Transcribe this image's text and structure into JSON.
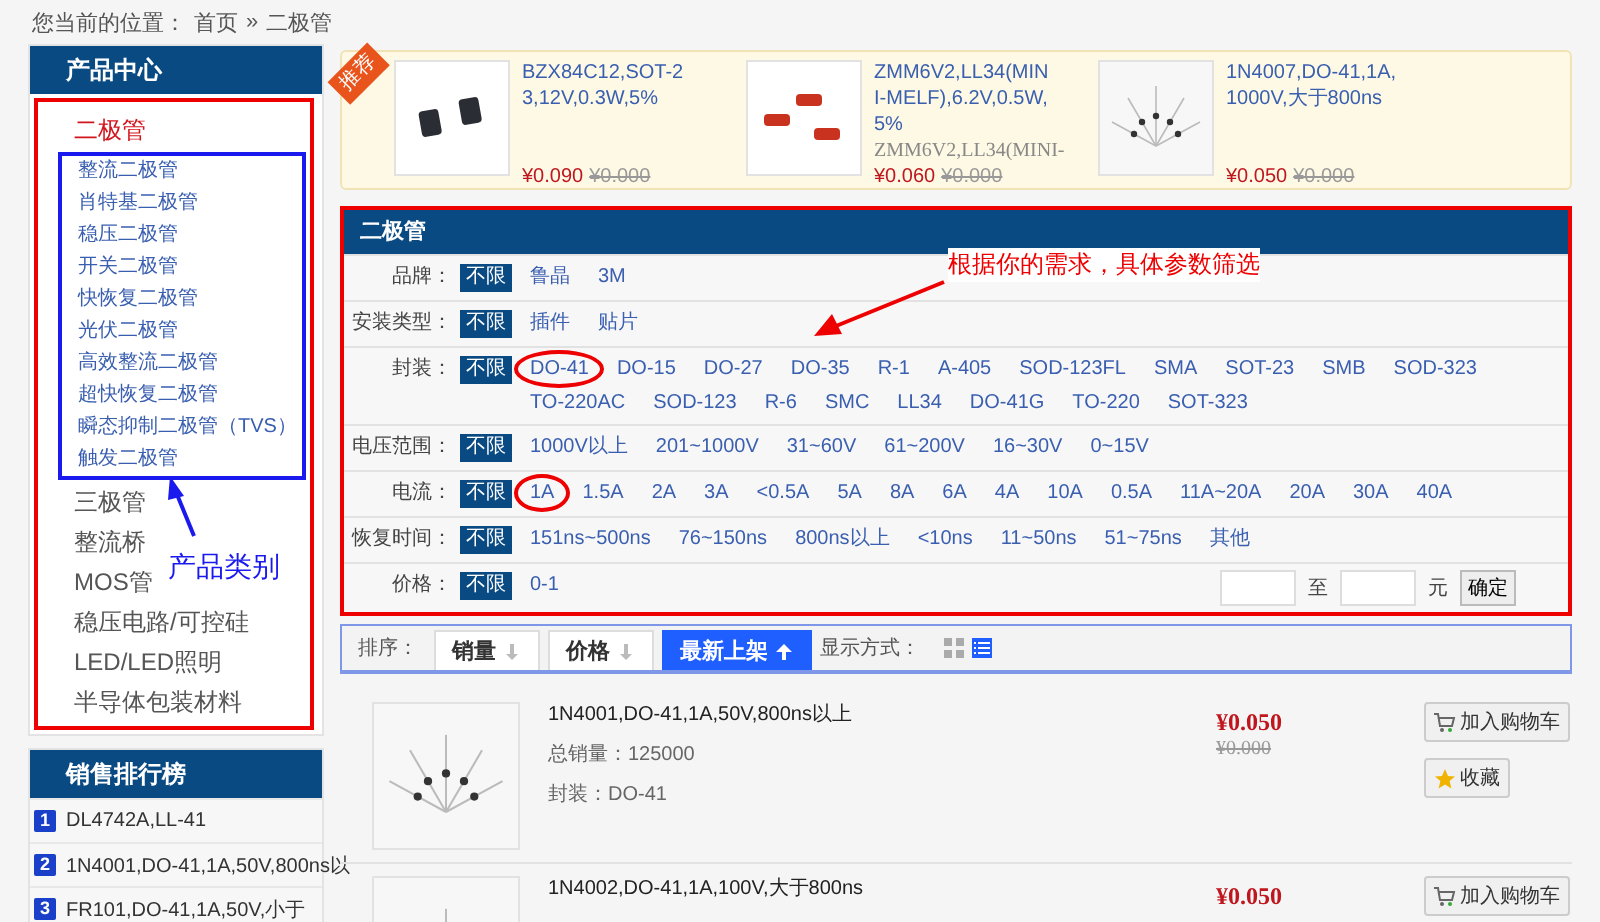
{
  "breadcrumb": {
    "prefix": "您当前的位置：",
    "home": "首页",
    "separator": "»",
    "current": "二极管"
  },
  "sidebar": {
    "title": "产品中心",
    "categories": [
      {
        "label": "二极管",
        "selected": true,
        "children": [
          {
            "label": "整流二极管"
          },
          {
            "label": "肖特基二极管"
          },
          {
            "label": "稳压二极管"
          },
          {
            "label": "开关二极管"
          },
          {
            "label": "快恢复二极管"
          },
          {
            "label": "光伏二极管"
          },
          {
            "label": "高效整流二极管"
          },
          {
            "label": "超快恢复二极管"
          },
          {
            "label": "瞬态抑制二极管（TVS）"
          },
          {
            "label": "触发二极管"
          }
        ]
      },
      {
        "label": "三极管",
        "selected": false
      },
      {
        "label": "整流桥",
        "selected": false
      },
      {
        "label": "MOS管",
        "selected": false
      },
      {
        "label": "稳压电路/可控硅",
        "selected": false
      },
      {
        "label": "LED/LED照明",
        "selected": false
      },
      {
        "label": "半导体包装材料",
        "selected": false
      }
    ]
  },
  "ranking": {
    "title": "销售排行榜",
    "items": [
      {
        "rank": "1",
        "name": "DL4742A,LL-41"
      },
      {
        "rank": "2",
        "name": "1N4001,DO-41,1A,50V,800ns以"
      },
      {
        "rank": "3",
        "name": "FR101,DO-41,1A,50V,小于"
      }
    ]
  },
  "promo": {
    "badge": "推荐",
    "items": [
      {
        "kind": "sot",
        "title": "BZX84C12,SOT-23,12V,0.3W,5%",
        "price": "¥0.090",
        "old_price": "¥0.000"
      },
      {
        "kind": "glass",
        "title": "ZMM6V2,LL34(MINI-MELF),6.2V,0.5W,5%",
        "subtitle": "ZMM6V2,LL34(MINI-",
        "price": "¥0.060",
        "old_price": "¥0.000"
      },
      {
        "kind": "axial",
        "title": "1N4007,DO-41,1A,1000V,大于800ns",
        "price": "¥0.050",
        "old_price": "¥0.000"
      }
    ]
  },
  "filter": {
    "title": "二极管",
    "rows": [
      {
        "label": "品牌：",
        "all": {
          "label": "不限",
          "selected": true
        },
        "options": [
          {
            "label": "鲁晶",
            "circled": false
          },
          {
            "label": "3M",
            "circled": false
          }
        ]
      },
      {
        "label": "安装类型：",
        "all": {
          "label": "不限",
          "selected": true
        },
        "options": [
          {
            "label": "插件",
            "circled": false
          },
          {
            "label": "贴片",
            "circled": false
          }
        ]
      },
      {
        "label": "封装：",
        "all": {
          "label": "不限",
          "selected": true
        },
        "options": [
          {
            "label": "DO-41",
            "circled": true
          },
          {
            "label": "DO-15",
            "circled": false
          },
          {
            "label": "DO-27",
            "circled": false
          },
          {
            "label": "DO-35",
            "circled": false
          },
          {
            "label": "R-1",
            "circled": false
          },
          {
            "label": "A-405",
            "circled": false
          },
          {
            "label": "SOD-123FL",
            "circled": false
          },
          {
            "label": "SMA",
            "circled": false
          },
          {
            "label": "SOT-23",
            "circled": false
          },
          {
            "label": "SMB",
            "circled": false
          },
          {
            "label": "SOD-323",
            "circled": false
          },
          {
            "label": "TO-220AC",
            "circled": false
          },
          {
            "label": "SOD-123",
            "circled": false
          },
          {
            "label": "R-6",
            "circled": false
          },
          {
            "label": "SMC",
            "circled": false
          },
          {
            "label": "LL34",
            "circled": false
          },
          {
            "label": "DO-41G",
            "circled": false
          },
          {
            "label": "TO-220",
            "circled": false
          },
          {
            "label": "SOT-323",
            "circled": false
          }
        ]
      },
      {
        "label": "电压范围：",
        "all": {
          "label": "不限",
          "selected": true
        },
        "options": [
          {
            "label": "1000V以上",
            "circled": false
          },
          {
            "label": "201~1000V",
            "circled": false
          },
          {
            "label": "31~60V",
            "circled": false
          },
          {
            "label": "61~200V",
            "circled": false
          },
          {
            "label": "16~30V",
            "circled": false
          },
          {
            "label": "0~15V",
            "circled": false
          }
        ]
      },
      {
        "label": "电流：",
        "all": {
          "label": "不限",
          "selected": true
        },
        "options": [
          {
            "label": "1A",
            "circled": true
          },
          {
            "label": "1.5A",
            "circled": false
          },
          {
            "label": "2A",
            "circled": false
          },
          {
            "label": "3A",
            "circled": false
          },
          {
            "label": "<0.5A",
            "circled": false
          },
          {
            "label": "5A",
            "circled": false
          },
          {
            "label": "8A",
            "circled": false
          },
          {
            "label": "6A",
            "circled": false
          },
          {
            "label": "4A",
            "circled": false
          },
          {
            "label": "10A",
            "circled": false
          },
          {
            "label": "0.5A",
            "circled": false
          },
          {
            "label": "11A~20A",
            "circled": false
          },
          {
            "label": "20A",
            "circled": false
          },
          {
            "label": "30A",
            "circled": false
          },
          {
            "label": "40A",
            "circled": false
          }
        ]
      },
      {
        "label": "恢复时间：",
        "all": {
          "label": "不限",
          "selected": true
        },
        "options": [
          {
            "label": "151ns~500ns",
            "circled": false
          },
          {
            "label": "76~150ns",
            "circled": false
          },
          {
            "label": "800ns以上",
            "circled": false
          },
          {
            "label": "<10ns",
            "circled": false
          },
          {
            "label": "11~50ns",
            "circled": false
          },
          {
            "label": "51~75ns",
            "circled": false
          },
          {
            "label": "其他",
            "circled": false
          }
        ]
      },
      {
        "label": "价格：",
        "all": {
          "label": "不限",
          "selected": true
        },
        "options": [
          {
            "label": "0-1",
            "circled": false
          }
        ],
        "range": {
          "to": "至",
          "unit": "元",
          "button": "确定"
        }
      }
    ]
  },
  "sort": {
    "label": "排序：",
    "options": [
      {
        "label": "销量",
        "selected": false
      },
      {
        "label": "价格",
        "selected": false
      },
      {
        "label": "最新上架",
        "selected": true
      }
    ],
    "view_label": "显示方式：",
    "views": [
      {
        "kind": "grid",
        "selected": false
      },
      {
        "kind": "list",
        "selected": true
      }
    ]
  },
  "products": [
    {
      "kind": "axial",
      "title": "1N4001,DO-41,1A,50V,800ns以上",
      "sales": "总销量：125000",
      "package": "封装：DO-41",
      "price": "¥0.050",
      "old_price": "¥0.000",
      "actions": [
        {
          "kind": "cart",
          "label": "加入购物车"
        },
        {
          "kind": "favorite",
          "label": "收藏"
        }
      ]
    },
    {
      "kind": "axial",
      "title": "1N4002,DO-41,1A,100V,大于800ns",
      "price": "¥0.050",
      "actions": [
        {
          "kind": "cart",
          "label": "加入购物车"
        }
      ]
    }
  ],
  "annotations": {
    "category_label": "产品类别",
    "filter_hint": "根据你的需求，具体参数筛选"
  }
}
